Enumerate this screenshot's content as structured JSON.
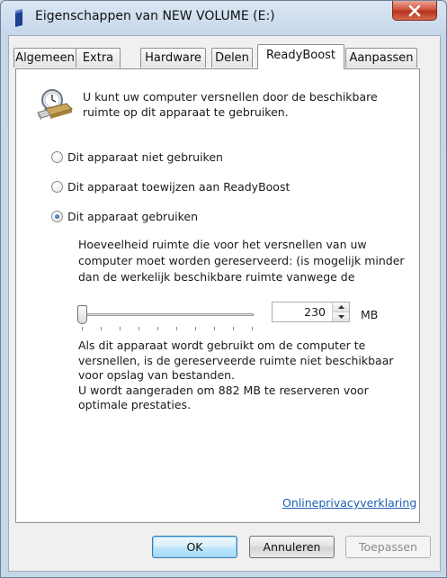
{
  "window": {
    "title": "Eigenschappen van NEW VOLUME (E:)",
    "icons": {
      "app": "drive-icon",
      "close": "close-icon"
    }
  },
  "tabs": [
    {
      "label": "Algemeen",
      "active": false
    },
    {
      "label": "Extra",
      "active": false
    },
    {
      "label": "Hardware",
      "active": false
    },
    {
      "label": "Delen",
      "active": false
    },
    {
      "label": "ReadyBoost",
      "active": true
    },
    {
      "label": "Aanpassen",
      "active": false
    }
  ],
  "readyboost": {
    "icon": "readyboost-stopwatch-usb-icon",
    "intro_line1": "U kunt uw computer versnellen door de beschikbare",
    "intro_line2": "ruimte op dit apparaat te gebruiken.",
    "options": [
      {
        "label": "Dit apparaat niet gebruiken",
        "checked": false
      },
      {
        "label": "Dit apparaat toewijzen aan ReadyBoost",
        "checked": false
      },
      {
        "label": "Dit apparaat gebruiken",
        "checked": true
      }
    ],
    "space_desc_line1": "Hoeveelheid ruimte die voor het versnellen van uw",
    "space_desc_line2": "computer moet worden gereserveerd: (is mogelijk minder",
    "space_desc_line3": "dan de werkelijk beschikbare ruimte vanwege de",
    "slider_level_fraction": 0.0,
    "amount_value": "230",
    "amount_unit": "MB",
    "note_line1": "Als dit apparaat wordt gebruikt om de computer te",
    "note_line2": "versnellen, is de gereserveerde ruimte niet beschikbaar",
    "note_line3": "voor opslag van bestanden.",
    "note_line4": "U wordt aangeraden om 882 MB te reserveren voor",
    "note_line5": "optimale prestaties.",
    "privacy_link": "Onlineprivacyverklaring"
  },
  "buttons": {
    "ok": "OK",
    "cancel": "Annuleren",
    "apply": "Toepassen"
  },
  "colors": {
    "link": "#1d5fb3",
    "default_button_border": "#3c7fb1",
    "close_button": "#c9452f"
  }
}
